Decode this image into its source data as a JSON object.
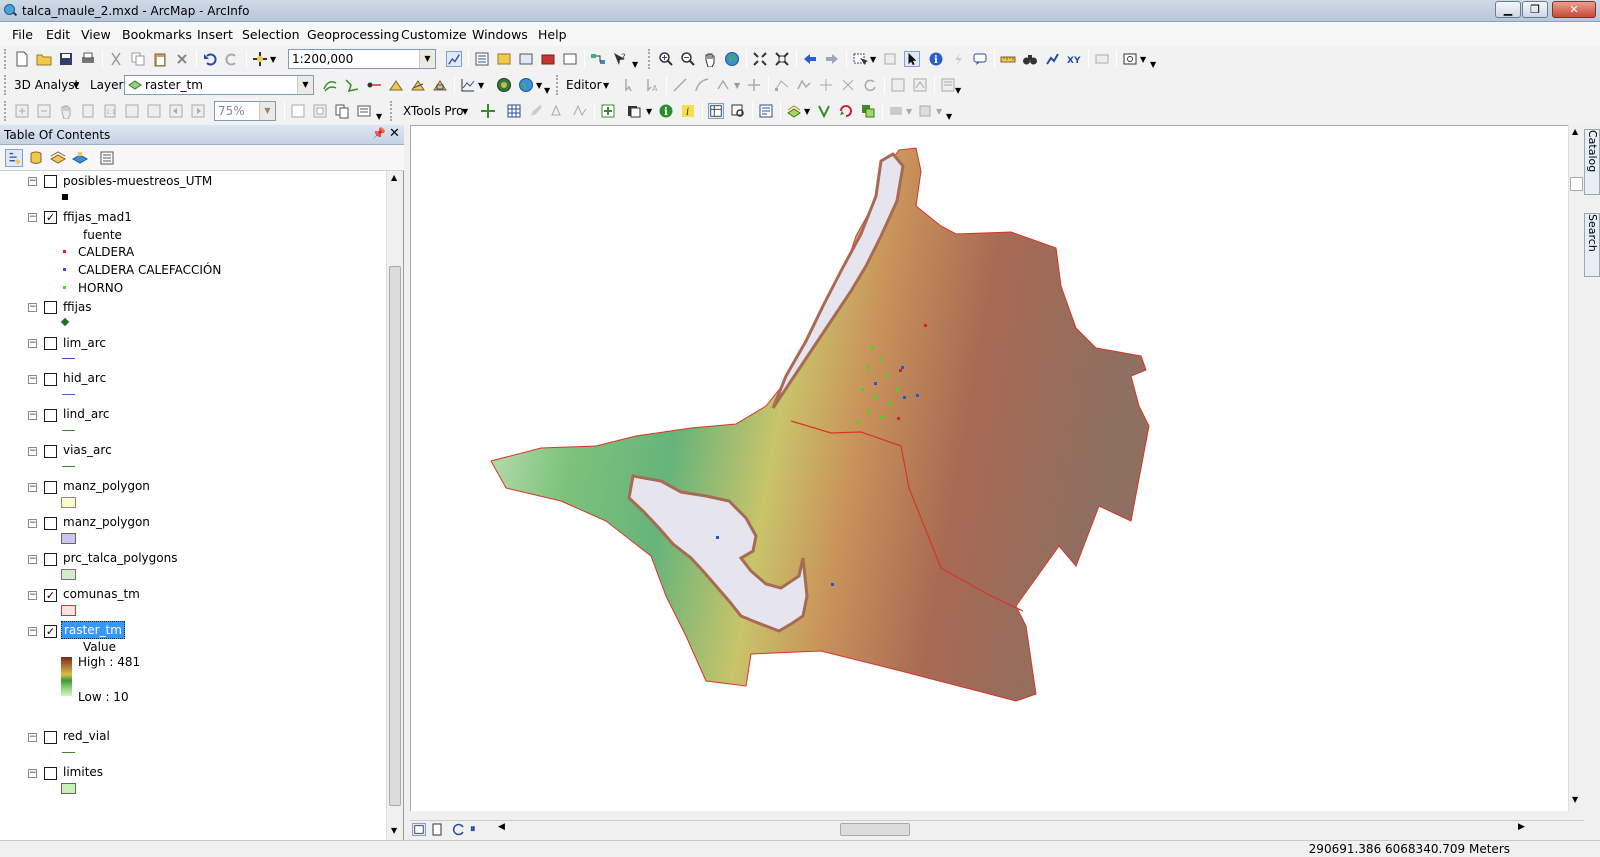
{
  "window": {
    "title": "talca_maule_2.mxd - ArcMap - ArcInfo"
  },
  "menu": [
    "File",
    "Edit",
    "View",
    "Bookmarks",
    "Insert",
    "Selection",
    "Geoprocessing",
    "Customize",
    "Windows",
    "Help"
  ],
  "toolbar1": {
    "scale": "1:200,000"
  },
  "toolbar2": {
    "analyst": "3D Analyst",
    "layer_label": "Layer:",
    "layer_value": "raster_tm",
    "editor": "Editor"
  },
  "toolbar3": {
    "zoom": "75%",
    "xtools": "XTools Pro"
  },
  "toc": {
    "title": "Table Of Contents",
    "layers": [
      {
        "name": "posibles-muestreos_UTM",
        "checked": false
      },
      {
        "name": "ffijas_mad1",
        "checked": true,
        "field": "fuente",
        "classes": [
          "CALDERA",
          "CALDERA CALEFACCIÓN",
          "HORNO"
        ]
      },
      {
        "name": "ffijas",
        "checked": false
      },
      {
        "name": "lim_arc",
        "checked": false
      },
      {
        "name": "hid_arc",
        "checked": false
      },
      {
        "name": "lind_arc",
        "checked": false
      },
      {
        "name": "vias_arc",
        "checked": false
      },
      {
        "name": "manz_polygon",
        "checked": false
      },
      {
        "name": "manz_polygon",
        "checked": false
      },
      {
        "name": "prc_talca_polygons",
        "checked": false
      },
      {
        "name": "comunas_tm",
        "checked": true
      },
      {
        "name": "raster_tm",
        "checked": true,
        "field": "Value",
        "high": "High : 481",
        "low": "Low : 10"
      },
      {
        "name": "red_vial",
        "checked": false
      },
      {
        "name": "limites",
        "checked": false
      }
    ]
  },
  "dock": {
    "catalog": "Catalog",
    "search": "Search"
  },
  "status": {
    "coordinates": "290691.386  6068340.709 Meters"
  },
  "colors": {
    "selection": "#3399ff",
    "caldera": "#e0201e",
    "calefaccion": "#2a55d0",
    "horno": "#36e11b",
    "boundary": "#d8342a"
  }
}
